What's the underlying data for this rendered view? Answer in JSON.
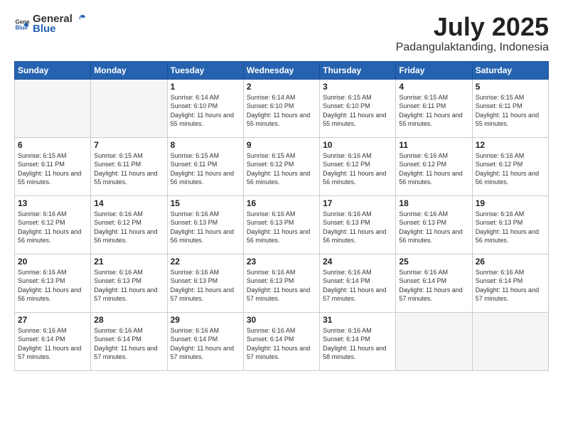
{
  "header": {
    "logo_general": "General",
    "logo_blue": "Blue",
    "month_title": "July 2025",
    "location": "Padangulaktanding, Indonesia"
  },
  "days_of_week": [
    "Sunday",
    "Monday",
    "Tuesday",
    "Wednesday",
    "Thursday",
    "Friday",
    "Saturday"
  ],
  "weeks": [
    [
      {
        "day": "",
        "info": ""
      },
      {
        "day": "",
        "info": ""
      },
      {
        "day": "1",
        "info": "Sunrise: 6:14 AM\nSunset: 6:10 PM\nDaylight: 11 hours and 55 minutes."
      },
      {
        "day": "2",
        "info": "Sunrise: 6:14 AM\nSunset: 6:10 PM\nDaylight: 11 hours and 55 minutes."
      },
      {
        "day": "3",
        "info": "Sunrise: 6:15 AM\nSunset: 6:10 PM\nDaylight: 11 hours and 55 minutes."
      },
      {
        "day": "4",
        "info": "Sunrise: 6:15 AM\nSunset: 6:11 PM\nDaylight: 11 hours and 55 minutes."
      },
      {
        "day": "5",
        "info": "Sunrise: 6:15 AM\nSunset: 6:11 PM\nDaylight: 11 hours and 55 minutes."
      }
    ],
    [
      {
        "day": "6",
        "info": "Sunrise: 6:15 AM\nSunset: 6:11 PM\nDaylight: 11 hours and 55 minutes."
      },
      {
        "day": "7",
        "info": "Sunrise: 6:15 AM\nSunset: 6:11 PM\nDaylight: 11 hours and 55 minutes."
      },
      {
        "day": "8",
        "info": "Sunrise: 6:15 AM\nSunset: 6:11 PM\nDaylight: 11 hours and 56 minutes."
      },
      {
        "day": "9",
        "info": "Sunrise: 6:15 AM\nSunset: 6:12 PM\nDaylight: 11 hours and 56 minutes."
      },
      {
        "day": "10",
        "info": "Sunrise: 6:16 AM\nSunset: 6:12 PM\nDaylight: 11 hours and 56 minutes."
      },
      {
        "day": "11",
        "info": "Sunrise: 6:16 AM\nSunset: 6:12 PM\nDaylight: 11 hours and 56 minutes."
      },
      {
        "day": "12",
        "info": "Sunrise: 6:16 AM\nSunset: 6:12 PM\nDaylight: 11 hours and 56 minutes."
      }
    ],
    [
      {
        "day": "13",
        "info": "Sunrise: 6:16 AM\nSunset: 6:12 PM\nDaylight: 11 hours and 56 minutes."
      },
      {
        "day": "14",
        "info": "Sunrise: 6:16 AM\nSunset: 6:12 PM\nDaylight: 11 hours and 56 minutes."
      },
      {
        "day": "15",
        "info": "Sunrise: 6:16 AM\nSunset: 6:13 PM\nDaylight: 11 hours and 56 minutes."
      },
      {
        "day": "16",
        "info": "Sunrise: 6:16 AM\nSunset: 6:13 PM\nDaylight: 11 hours and 56 minutes."
      },
      {
        "day": "17",
        "info": "Sunrise: 6:16 AM\nSunset: 6:13 PM\nDaylight: 11 hours and 56 minutes."
      },
      {
        "day": "18",
        "info": "Sunrise: 6:16 AM\nSunset: 6:13 PM\nDaylight: 11 hours and 56 minutes."
      },
      {
        "day": "19",
        "info": "Sunrise: 6:16 AM\nSunset: 6:13 PM\nDaylight: 11 hours and 56 minutes."
      }
    ],
    [
      {
        "day": "20",
        "info": "Sunrise: 6:16 AM\nSunset: 6:13 PM\nDaylight: 11 hours and 56 minutes."
      },
      {
        "day": "21",
        "info": "Sunrise: 6:16 AM\nSunset: 6:13 PM\nDaylight: 11 hours and 57 minutes."
      },
      {
        "day": "22",
        "info": "Sunrise: 6:16 AM\nSunset: 6:13 PM\nDaylight: 11 hours and 57 minutes."
      },
      {
        "day": "23",
        "info": "Sunrise: 6:16 AM\nSunset: 6:13 PM\nDaylight: 11 hours and 57 minutes."
      },
      {
        "day": "24",
        "info": "Sunrise: 6:16 AM\nSunset: 6:14 PM\nDaylight: 11 hours and 57 minutes."
      },
      {
        "day": "25",
        "info": "Sunrise: 6:16 AM\nSunset: 6:14 PM\nDaylight: 11 hours and 57 minutes."
      },
      {
        "day": "26",
        "info": "Sunrise: 6:16 AM\nSunset: 6:14 PM\nDaylight: 11 hours and 57 minutes."
      }
    ],
    [
      {
        "day": "27",
        "info": "Sunrise: 6:16 AM\nSunset: 6:14 PM\nDaylight: 11 hours and 57 minutes."
      },
      {
        "day": "28",
        "info": "Sunrise: 6:16 AM\nSunset: 6:14 PM\nDaylight: 11 hours and 57 minutes."
      },
      {
        "day": "29",
        "info": "Sunrise: 6:16 AM\nSunset: 6:14 PM\nDaylight: 11 hours and 57 minutes."
      },
      {
        "day": "30",
        "info": "Sunrise: 6:16 AM\nSunset: 6:14 PM\nDaylight: 11 hours and 57 minutes."
      },
      {
        "day": "31",
        "info": "Sunrise: 6:16 AM\nSunset: 6:14 PM\nDaylight: 11 hours and 58 minutes."
      },
      {
        "day": "",
        "info": ""
      },
      {
        "day": "",
        "info": ""
      }
    ]
  ]
}
